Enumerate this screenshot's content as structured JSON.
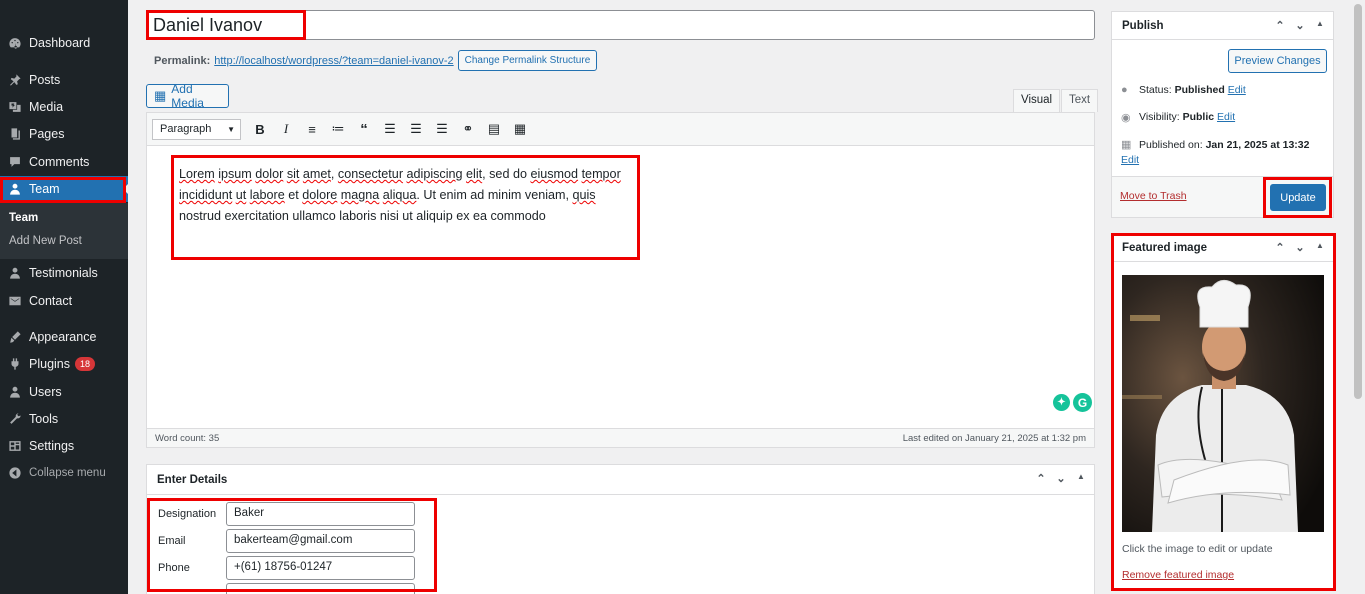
{
  "sidebar": {
    "items": [
      {
        "label": "Dashboard",
        "icon": "dashboard-icon"
      },
      {
        "label": "Posts",
        "icon": "pin-icon"
      },
      {
        "label": "Media",
        "icon": "media-icon"
      },
      {
        "label": "Pages",
        "icon": "pages-icon"
      },
      {
        "label": "Comments",
        "icon": "comments-icon"
      },
      {
        "label": "Team",
        "icon": "team-icon"
      },
      {
        "label": "Testimonials",
        "icon": "user-icon"
      },
      {
        "label": "Contact",
        "icon": "mail-icon"
      },
      {
        "label": "Appearance",
        "icon": "brush-icon"
      },
      {
        "label": "Plugins",
        "icon": "plugin-icon",
        "badge": "18"
      },
      {
        "label": "Users",
        "icon": "users-icon"
      },
      {
        "label": "Tools",
        "icon": "wrench-icon"
      },
      {
        "label": "Settings",
        "icon": "settings-icon"
      },
      {
        "label": "Collapse menu",
        "icon": "collapse-icon"
      }
    ],
    "submenu": [
      "Team",
      "Add New Post"
    ]
  },
  "editor": {
    "title": "Daniel Ivanov",
    "permalink_label": "Permalink:",
    "permalink_url": "http://localhost/wordpress/?team=daniel-ivanov-2",
    "permalink_button": "Change Permalink Structure",
    "add_media": "Add Media",
    "tab_visual": "Visual",
    "tab_text": "Text",
    "format": "Paragraph",
    "content_parts": [
      {
        "text": "Lorem",
        "spell": true
      },
      {
        "text": " ",
        "spell": false
      },
      {
        "text": "ipsum",
        "spell": true
      },
      {
        "text": " ",
        "spell": false
      },
      {
        "text": "dolor",
        "spell": true
      },
      {
        "text": " ",
        "spell": false
      },
      {
        "text": "sit",
        "spell": true
      },
      {
        "text": " ",
        "spell": false
      },
      {
        "text": "amet",
        "spell": true
      },
      {
        "text": ", ",
        "spell": false
      },
      {
        "text": "consectetur",
        "spell": true
      },
      {
        "text": " ",
        "spell": false
      },
      {
        "text": "adipiscing",
        "spell": true
      },
      {
        "text": " ",
        "spell": false
      },
      {
        "text": "elit",
        "spell": true
      },
      {
        "text": ", sed do ",
        "spell": false
      },
      {
        "text": "eiusmod",
        "spell": true
      },
      {
        "text": " ",
        "spell": false
      },
      {
        "text": "tempor",
        "spell": true
      },
      {
        "text": " ",
        "spell": false
      },
      {
        "text": "incididunt",
        "spell": true
      },
      {
        "text": " ",
        "spell": false
      },
      {
        "text": "ut",
        "spell": true
      },
      {
        "text": " ",
        "spell": false
      },
      {
        "text": "labore",
        "spell": true
      },
      {
        "text": " et ",
        "spell": false
      },
      {
        "text": "dolore",
        "spell": true
      },
      {
        "text": " ",
        "spell": false
      },
      {
        "text": "magna",
        "spell": true
      },
      {
        "text": " ",
        "spell": false
      },
      {
        "text": "aliqua",
        "spell": true
      },
      {
        "text": ". Ut enim ad minim veniam, ",
        "spell": false
      },
      {
        "text": "quis",
        "spell": true
      },
      {
        "text": " nostrud exercitation ullamco laboris nisi ut aliquip ex ea commodo",
        "spell": false
      }
    ],
    "word_count": "Word count: 35",
    "last_edited": "Last edited on January 21, 2025 at 1:32 pm"
  },
  "details": {
    "title": "Enter Details",
    "fields": [
      {
        "label": "Designation",
        "value": "Baker"
      },
      {
        "label": "Email",
        "value": "bakerteam@gmail.com"
      },
      {
        "label": "Phone",
        "value": "+(61) 18756-01247"
      }
    ]
  },
  "publish": {
    "title": "Publish",
    "preview": "Preview Changes",
    "status_label": "Status:",
    "status_value": "Published",
    "visibility_label": "Visibility:",
    "visibility_value": "Public",
    "published_label": "Published on:",
    "published_value": "Jan 21, 2025 at 13:32",
    "edit": "Edit",
    "trash": "Move to Trash",
    "update": "Update"
  },
  "featured": {
    "title": "Featured image",
    "hint": "Click the image to edit or update",
    "remove": "Remove featured image"
  },
  "colors": {
    "accent": "#2271b1",
    "highlight": "#e00000",
    "sidebar": "#1d2327"
  }
}
